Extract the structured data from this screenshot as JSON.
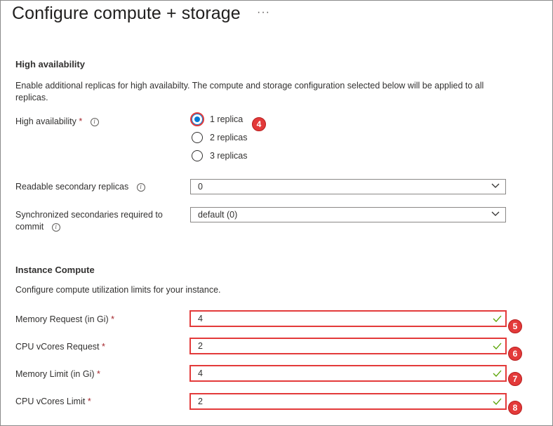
{
  "header": {
    "title": "Configure compute + storage",
    "more_label": "···"
  },
  "high_availability": {
    "heading": "High availability",
    "description": "Enable additional replicas for high availabilty. The compute and storage configuration selected below will be applied to all replicas.",
    "field_label": "High availability",
    "required_mark": "*",
    "options": [
      "1 replica",
      "2 replicas",
      "3 replicas"
    ],
    "selected": "1 replica",
    "readable_secondary": {
      "label": "Readable secondary replicas",
      "value": "0"
    },
    "sync_secondaries": {
      "label_line1": "Synchronized secondaries required to",
      "label_line2": "commit",
      "value": "default (0)"
    }
  },
  "instance_compute": {
    "heading": "Instance Compute",
    "description": "Configure compute utilization limits for your instance.",
    "fields": [
      {
        "label": "Memory Request (in Gi)",
        "value": "4"
      },
      {
        "label": "CPU vCores Request",
        "value": "2"
      },
      {
        "label": "Memory Limit (in Gi)",
        "value": "4"
      },
      {
        "label": "CPU vCores Limit",
        "value": "2"
      }
    ]
  },
  "callouts": [
    "4",
    "5",
    "6",
    "7",
    "8"
  ],
  "colors": {
    "accent": "#0078d4",
    "highlight": "#e33a3a",
    "valid": "#57a300",
    "required": "#a4262c"
  },
  "icons": {
    "info": "info-icon",
    "chevron": "chevron-down-icon",
    "valid": "checkmark-icon",
    "more": "more-icon"
  }
}
